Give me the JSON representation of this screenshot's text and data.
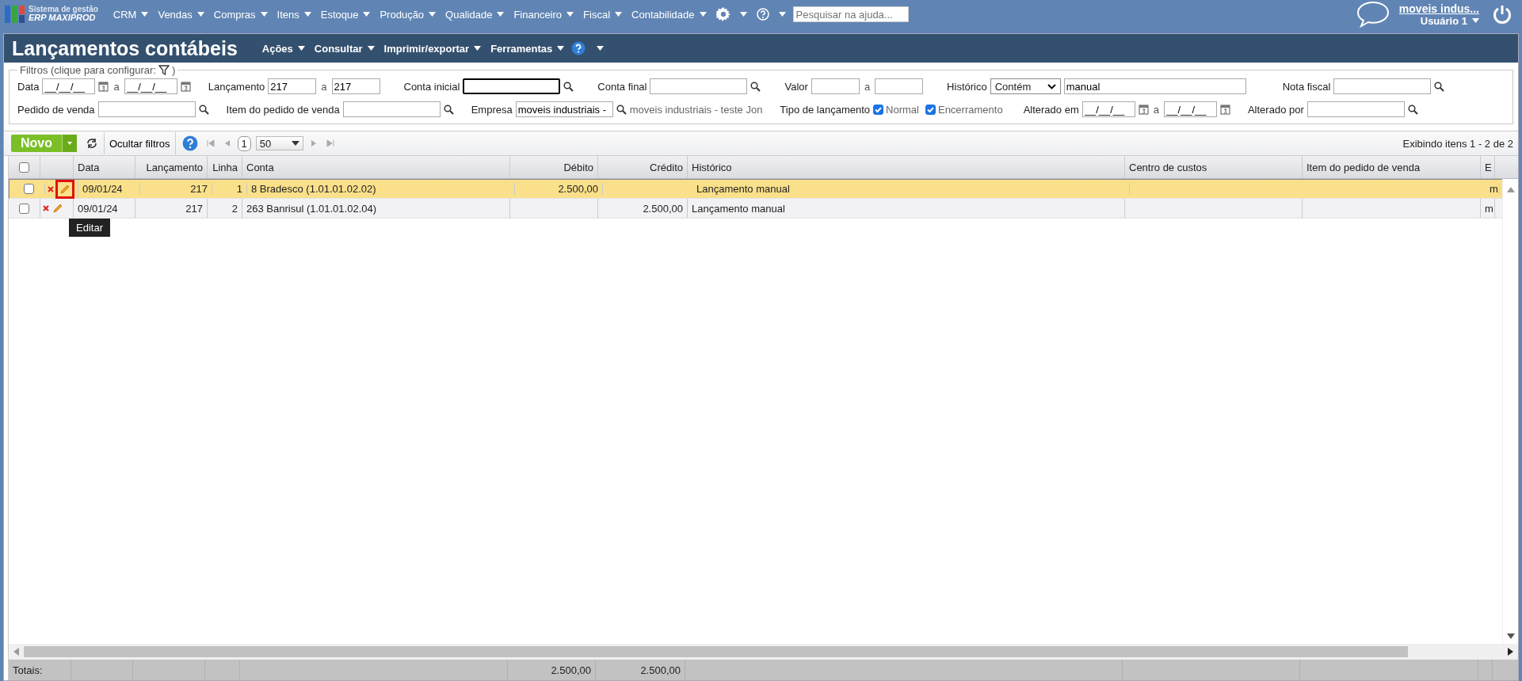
{
  "topbar": {
    "logo_line1": "Sistema de gestão",
    "logo_line2": "ERP MAXIPROD",
    "menus": [
      "CRM",
      "Vendas",
      "Compras",
      "Itens",
      "Estoque",
      "Produção",
      "Qualidade",
      "Financeiro",
      "Fiscal",
      "Contabilidade"
    ],
    "search": {
      "placeholder": "Pesquisar na ajuda..."
    },
    "company": "moveis indus...",
    "user": "Usuário 1"
  },
  "page": {
    "title": "Lançamentos contábeis",
    "menus": [
      "Ações",
      "Consultar",
      "Imprimir/exportar",
      "Ferramentas"
    ]
  },
  "filters": {
    "legend": "Filtros (clique para configurar:",
    "legend_close": ")",
    "line_1": [
      {
        "kind": "date_range",
        "label": "Data",
        "from": "__/__/__",
        "sep": "a",
        "to": "__/__/__"
      },
      {
        "kind": "range",
        "label": "Lançamento",
        "from": "217",
        "sep": "a",
        "to": "217"
      },
      {
        "kind": "lookup",
        "label": "Conta inicial",
        "focused": true
      },
      {
        "kind": "lookup",
        "label": "Conta final",
        "focused": false
      },
      {
        "kind": "range",
        "label": "Valor",
        "sep": "a"
      },
      {
        "kind": "select_text",
        "label": "Histórico",
        "option": "Contém",
        "value": "manual"
      },
      {
        "kind": "lookup",
        "label": "Nota fiscal",
        "focused": false
      }
    ],
    "line_2": [
      {
        "kind": "lookup",
        "label": "Pedido de venda",
        "focused": false
      },
      {
        "kind": "lookup",
        "label": "Item do pedido de venda",
        "focused": false
      },
      {
        "kind": "lookup",
        "label": "Empresa",
        "value": "moveis industriais -",
        "note": "moveis industriais - teste Jon",
        "focused": false
      },
      {
        "kind": "checks",
        "label": "Tipo de lançamento",
        "options": [
          {
            "label": "Normal",
            "checked": true
          },
          {
            "label": "Encerramento",
            "checked": true
          }
        ]
      },
      {
        "kind": "date_range",
        "label": "Alterado em",
        "from": "__/__/__",
        "sep": "a",
        "to": "__/__/__"
      },
      {
        "kind": "lookup",
        "label": "Alterado por",
        "focused": false
      }
    ]
  },
  "toolbar": {
    "new_button": "Novo",
    "hide_filters": "Ocultar filtros",
    "page": "1",
    "page_size": "50",
    "summary": "Exibindo itens 1 - 2 de 2"
  },
  "table": {
    "all_selected": false,
    "columns": [
      {
        "label": "Data",
        "kind": "text"
      },
      {
        "label": "Lançamento",
        "kind": "number"
      },
      {
        "label": "Linha",
        "kind": "number"
      },
      {
        "label": "Conta",
        "kind": "text"
      },
      {
        "label": "Débito",
        "kind": "number",
        "total": "2.500,00"
      },
      {
        "label": "Crédito",
        "kind": "number",
        "total": "2.500,00"
      },
      {
        "label": "Histórico",
        "kind": "text"
      },
      {
        "label": "Centro de custos",
        "kind": "text"
      },
      {
        "label": "Item do pedido de venda",
        "kind": "text"
      },
      {
        "label": "E",
        "kind": "text"
      }
    ],
    "rows": [
      {
        "selected": true,
        "checked": false,
        "edit_highlighted": true,
        "tooltip": "Editar",
        "cells": [
          "09/01/24",
          "217",
          "1",
          "8 Bradesco (1.01.01.02.02)",
          "2.500,00",
          null,
          "Lançamento manual",
          null,
          null,
          "m"
        ]
      },
      {
        "selected": false,
        "checked": false,
        "edit_highlighted": false,
        "cells": [
          "09/01/24",
          "217",
          "2",
          "263 Banrisul (1.01.01.02.04)",
          null,
          "2.500,00",
          "Lançamento manual",
          null,
          null,
          "m"
        ]
      }
    ],
    "totals_label": "Totais:"
  }
}
